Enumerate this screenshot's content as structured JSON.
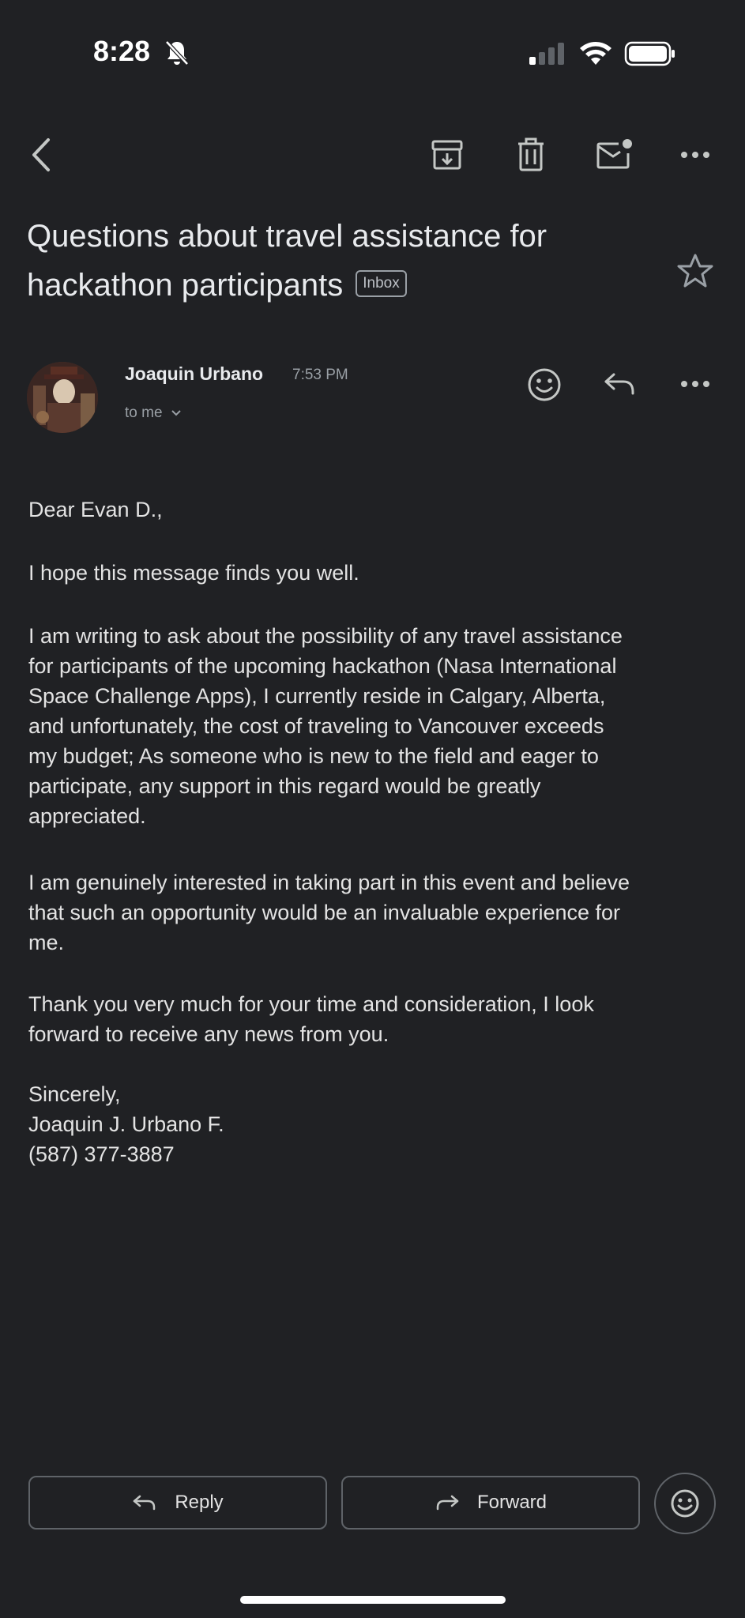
{
  "status_bar": {
    "time": "8:28"
  },
  "toolbar": {
    "icons": [
      "back-arrow-icon",
      "archive-icon",
      "trash-icon",
      "mark-unread-icon",
      "more-horizontal-icon"
    ]
  },
  "subject": {
    "text": "Questions about travel assistance for hackathon participants",
    "label_chip": "Inbox"
  },
  "sender": {
    "name": "Joaquin Urbano",
    "time": "7:53 PM",
    "recipient": "to me"
  },
  "body": {
    "greeting": "Dear Evan D.,",
    "hope": "I hope this message finds you well.",
    "main_lines": [
      "I am writing to ask about the possibility of any travel assistance",
      "for participants of the upcoming hackathon (Nasa International",
      "Space Challenge Apps), I currently reside in Calgary, Alberta,",
      "and unfortunately, the cost of traveling to Vancouver exceeds",
      "my budget; As someone who is new to the field and eager to",
      "participate, any support in this regard would be greatly",
      "appreciated."
    ],
    "interest_lines": [
      "I am genuinely interested in taking part in this event and believe",
      "that such an opportunity would be an invaluable experience for",
      "me."
    ],
    "thanks_lines": [
      "Thank you very much for your time and consideration, I look",
      "forward to receive any news from you."
    ],
    "signature": {
      "closing": "Sincerely,",
      "name": "Joaquin J. Urbano F.",
      "phone": "(587) 377-3887"
    }
  },
  "actions": {
    "reply_label": "Reply",
    "forward_label": "Forward"
  },
  "colors": {
    "background": "#202124",
    "text": "#e3e3e3",
    "muted": "#9aa0a6",
    "border": "#5f6368"
  }
}
